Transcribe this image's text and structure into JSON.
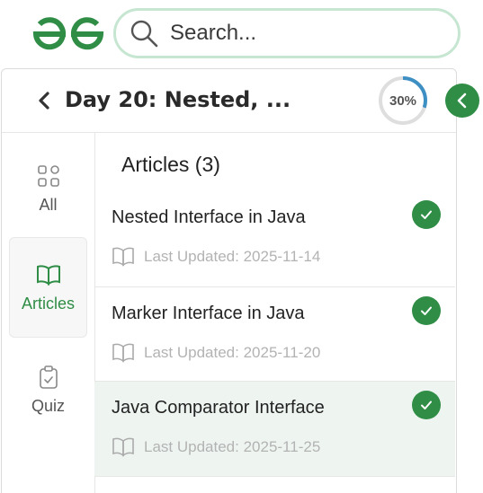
{
  "search": {
    "placeholder": "Search..."
  },
  "header": {
    "title": "Day 20: Nested, ...",
    "progress_label": "30%",
    "progress": 0.3
  },
  "nav": {
    "items": [
      {
        "label": "All",
        "icon": "grid-icon",
        "active": false
      },
      {
        "label": "Articles",
        "icon": "book-icon",
        "active": true
      },
      {
        "label": "Quiz",
        "icon": "clipboard-icon",
        "active": false
      }
    ]
  },
  "content": {
    "section_title": "Articles (3)",
    "articles": [
      {
        "title": "Nested Interface in Java",
        "meta": "Last Updated: 2025-11-14",
        "completed": true
      },
      {
        "title": "Marker Interface in Java",
        "meta": "Last Updated: 2025-11-20",
        "completed": true
      },
      {
        "title": "Java Comparator Interface",
        "meta": "Last Updated: 2025-11-25",
        "completed": true
      }
    ]
  },
  "colors": {
    "brand": "#2f8d46",
    "progress": "#3d8fc4",
    "highlight": "#eef5f1"
  }
}
